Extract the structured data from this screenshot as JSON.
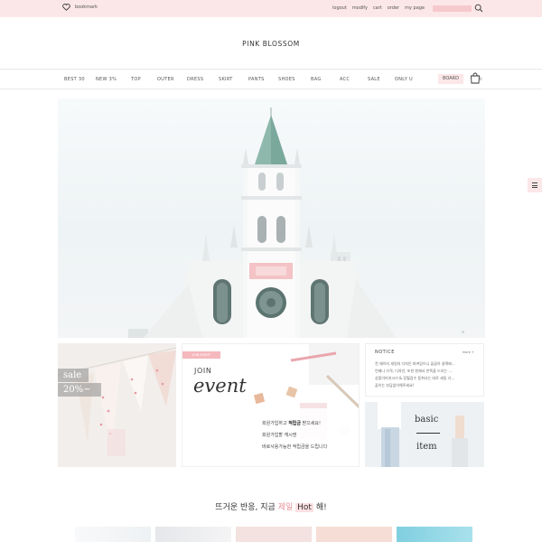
{
  "topbar": {
    "bookmark": "bookmark",
    "links": [
      "logout",
      "modify",
      "cart",
      "order",
      "my page"
    ]
  },
  "logo": "PINK BLOSSOM",
  "gnb": {
    "items": [
      "BEST 30",
      "NEW 3%",
      "TOP",
      "OUTER",
      "DRESS",
      "SKIRT",
      "PANTS",
      "SHOES",
      "BAG",
      "ACC",
      "SALE",
      "ONLY U"
    ],
    "board": "BOARD",
    "cart_count": "0"
  },
  "sale": {
    "label": "sale",
    "percent": "20%~"
  },
  "event": {
    "join": "JOIN",
    "title": "event",
    "lines": [
      {
        "pre": "회원가입하고 ",
        "bold": "적립금",
        "post": " 받으세요!"
      },
      {
        "pre": "회원가입할 캐시앤",
        "bold": "",
        "post": ""
      },
      {
        "pre": "바로사용가능한 적립금을 드립니다",
        "bold": "",
        "post": ""
      }
    ]
  },
  "notice": {
    "title": "NOTICE",
    "more": "more +",
    "lines": [
      "전 제이지 세일처 디자인 퍼켜있으니 꿈꿈히 살펴봐...",
      "언제나 가격, 디자인, 또한 현재서 만족을 드리는 ...",
      "상품이미지크기 & 장혈검수 동취사는 대로 세팅 기...",
      "꿈이는 부담없이해주세요!"
    ]
  },
  "basic": {
    "line1": "basic",
    "line2": "item"
  },
  "headline": {
    "pre": "뜨거운 반응, 지금 ",
    "pink": "제일",
    "hot": "Hot",
    "post": " 해!"
  },
  "colors": {
    "pink_bar": "#fce7e8",
    "pink_accent": "#f4b8bd",
    "text": "#333333"
  }
}
